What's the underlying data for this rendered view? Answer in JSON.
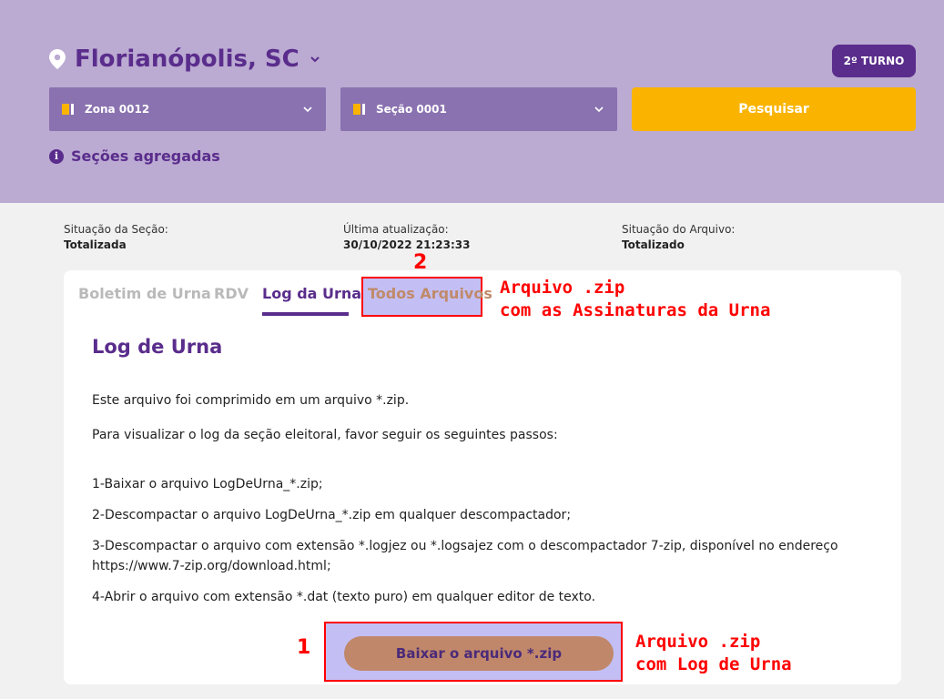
{
  "header": {
    "city": "Florianópolis, SC",
    "turno": "2º TURNO",
    "zona": "Zona 0012",
    "secao": "Seção 0001",
    "search_button": "Pesquisar",
    "secoes_agregadas": "Seções agregadas",
    "colors": {
      "background": "#bbaad2",
      "primary": "#5a2d8c",
      "select": "#8a72b0",
      "accent": "#fab400"
    }
  },
  "status": {
    "secao_label": "Situação da Seção:",
    "secao_value": "Totalizada",
    "atualizacao_label": "Última atualização:",
    "atualizacao_value": "30/10/2022 21:23:33",
    "arquivo_label": "Situação do Arquivo:",
    "arquivo_value": "Totalizado"
  },
  "tabs": [
    {
      "label": "Boletim de Urna",
      "active": false
    },
    {
      "label": "RDV",
      "active": false
    },
    {
      "label": "Log da Urna",
      "active": true
    },
    {
      "label": "Todos Arquivos",
      "active": false
    }
  ],
  "content": {
    "title": "Log de Urna",
    "p1": "Este arquivo foi comprimido em um arquivo *.zip.",
    "p2": "Para visualizar o log da seção eleitoral, favor seguir os seguintes passos:",
    "step1": "1-Baixar o arquivo LogDeUrna_*.zip;",
    "step2": "2-Descompactar o arquivo LogDeUrna_*.zip em qualquer descompactador;",
    "step3": "3-Descompactar o arquivo com extensão *.logjez ou *.logsajez com o descompactador 7-zip, disponível no endereço https://www.7-zip.org/download.html;",
    "step4": "4-Abrir o arquivo com extensão *.dat (texto puro) em qualquer editor de texto.",
    "download_button": "Baixar o arquivo *.zip"
  },
  "annotations": {
    "num1": "1",
    "num2": "2",
    "note2_line1": "Arquivo .zip",
    "note2_line2": "com as Assinaturas da Urna",
    "note1_line1": "Arquivo .zip",
    "note1_line2": "com Log de Urna"
  },
  "icons": [
    "location-pin-icon",
    "chevron-down-icon",
    "info-icon"
  ]
}
